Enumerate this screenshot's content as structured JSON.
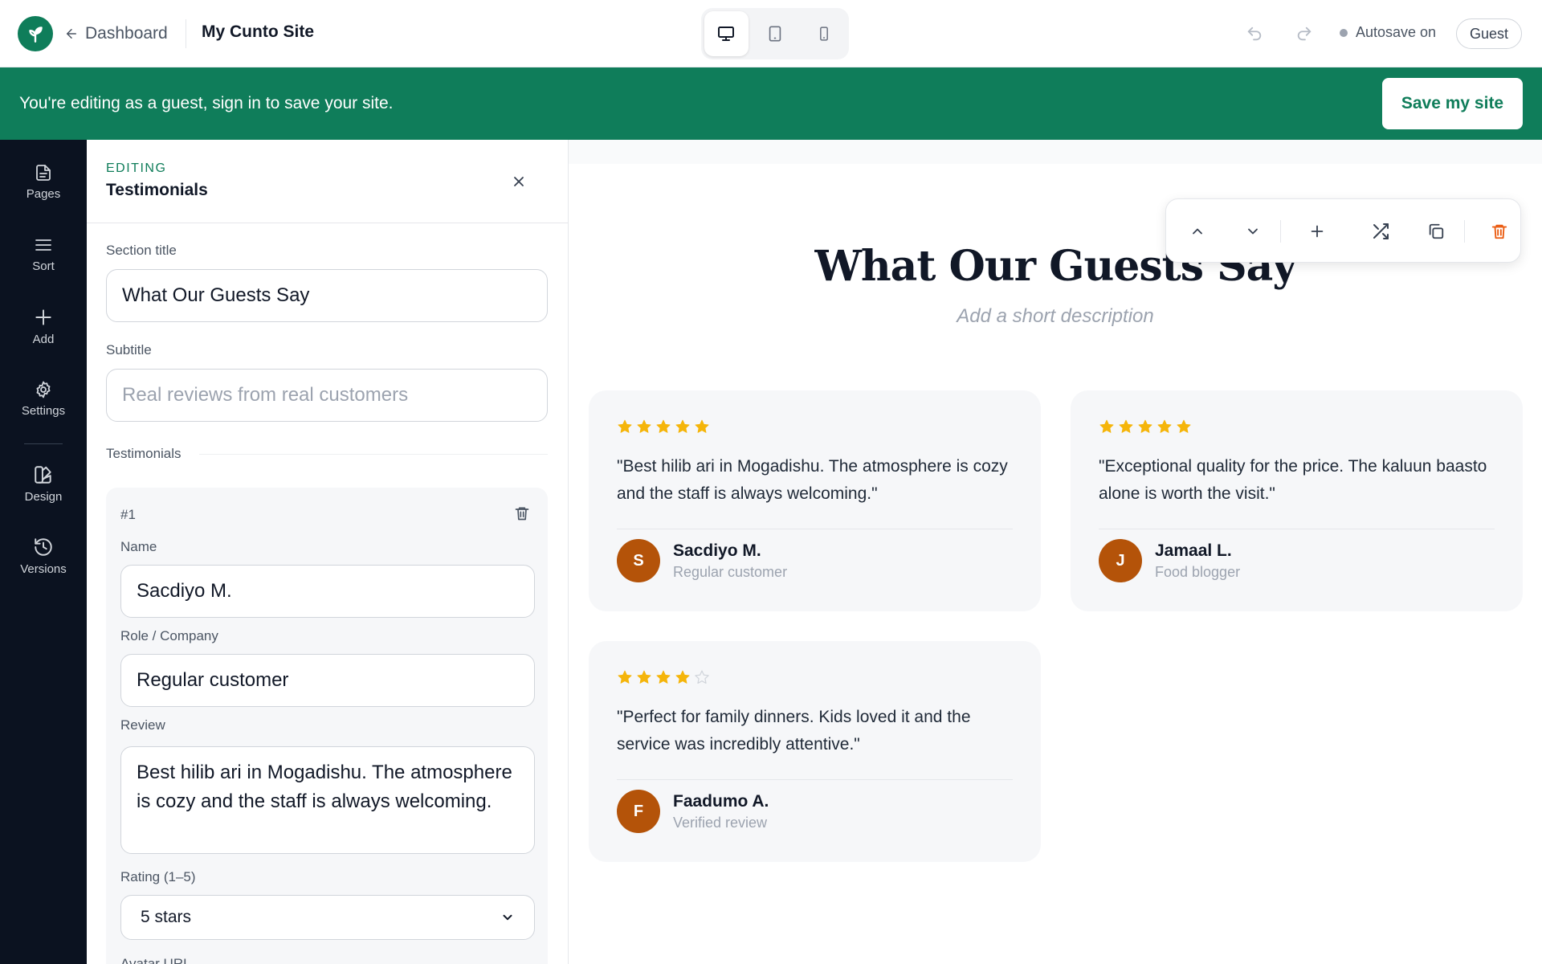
{
  "topbar": {
    "back_label": "Dashboard",
    "site_name": "My Cunto Site",
    "devices": [
      "desktop-icon",
      "tablet-icon",
      "mobile-icon"
    ],
    "active_device": "desktop",
    "autosave_label": "Autosave on",
    "user_label": "Guest"
  },
  "banner": {
    "message": "You're editing as a guest, sign in to save your site.",
    "save_label": "Save my site"
  },
  "rail": {
    "items": [
      {
        "label": "Pages",
        "icon": "file-icon"
      },
      {
        "label": "Sort",
        "icon": "menu-icon"
      },
      {
        "label": "Add",
        "icon": "plus-icon"
      },
      {
        "label": "Settings",
        "icon": "gear-icon"
      },
      {
        "label": "Design",
        "icon": "palette-icon"
      },
      {
        "label": "Versions",
        "icon": "history-icon"
      }
    ]
  },
  "panel": {
    "editing_label": "EDITING",
    "title": "Testimonials",
    "section_title_label": "Section title",
    "section_title_value": "What Our Guests Say",
    "subtitle_label": "Subtitle",
    "subtitle_placeholder": "Real reviews from real customers",
    "list_label": "Testimonials",
    "item": {
      "number": "#1",
      "name_label": "Name",
      "name_value": "Sacdiyo M.",
      "role_label": "Role / Company",
      "role_value": "Regular customer",
      "review_label": "Review",
      "review_value": "Best hilib ari in Mogadishu. The atmosphere is cozy and the staff is always welcoming.",
      "rating_label": "Rating (1–5)",
      "rating_value": "5 stars",
      "avatar_label": "Avatar URL"
    }
  },
  "preview": {
    "title": "What Our Guests Say",
    "subtitle_placeholder": "Add a short description",
    "toolbar_icons": [
      "chevron-up-icon",
      "chevron-down-icon",
      "plus-icon",
      "shuffle-icon",
      "copy-icon",
      "trash-icon"
    ],
    "testimonials": [
      {
        "quote": "\"Best hilib ari in Mogadishu. The atmosphere is cozy and the staff is always welcoming.\"",
        "name": "Sacdiyo M.",
        "role": "Regular customer",
        "initial": "S",
        "rating": 5
      },
      {
        "quote": "\"Exceptional quality for the price. The kaluun baasto alone is worth the visit.\"",
        "name": "Jamaal L.",
        "role": "Food blogger",
        "initial": "J",
        "rating": 5
      },
      {
        "quote": "\"Perfect for family dinners. Kids loved it and the service was incredibly attentive.\"",
        "name": "Faadumo A.",
        "role": "Verified review",
        "initial": "F",
        "rating": 4
      }
    ]
  },
  "colors": {
    "brand": "#0f7d5a",
    "rail": "#0b1220",
    "star": "#f5b50a",
    "star_empty": "#d1d5db",
    "avatar": "#b45309",
    "danger": "#ea580c"
  }
}
